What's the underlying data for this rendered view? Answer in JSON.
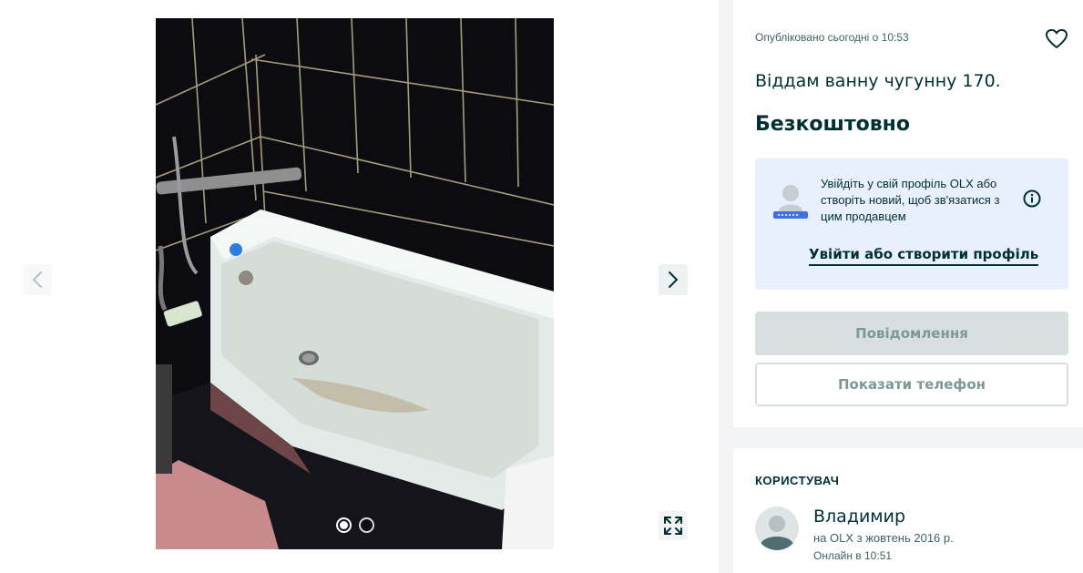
{
  "gallery": {
    "current_slide": 1,
    "total_slides": 2,
    "prev_icon": "chevron-left-icon",
    "next_icon": "chevron-right-icon",
    "fullscreen_icon": "expand-icon"
  },
  "ad": {
    "posted": "Опубліковано сьогодні о 10:53",
    "favorite_icon": "heart-icon",
    "title": "Віддам ванну чугунну 170.",
    "price": "Безкоштовно"
  },
  "login_prompt": {
    "text": "Увійдіть у свій профіль OLX або створіть новий, щоб зв'язатися з цим продавцем",
    "link_label": "Увійти або створити профіль",
    "info_icon": "info-icon"
  },
  "actions": {
    "message_label": "Повідомлення",
    "phone_label": "Показати телефон"
  },
  "user": {
    "heading": "КОРИСТУВАЧ",
    "name": "Владимир",
    "since": "на OLX з жовтень 2016 р.",
    "online": "Онлайн в 10:51"
  },
  "colors": {
    "primary": "#002f34",
    "muted": "#406367",
    "login_bg": "#e8effd",
    "button_disabled": "#d8dfe0"
  }
}
